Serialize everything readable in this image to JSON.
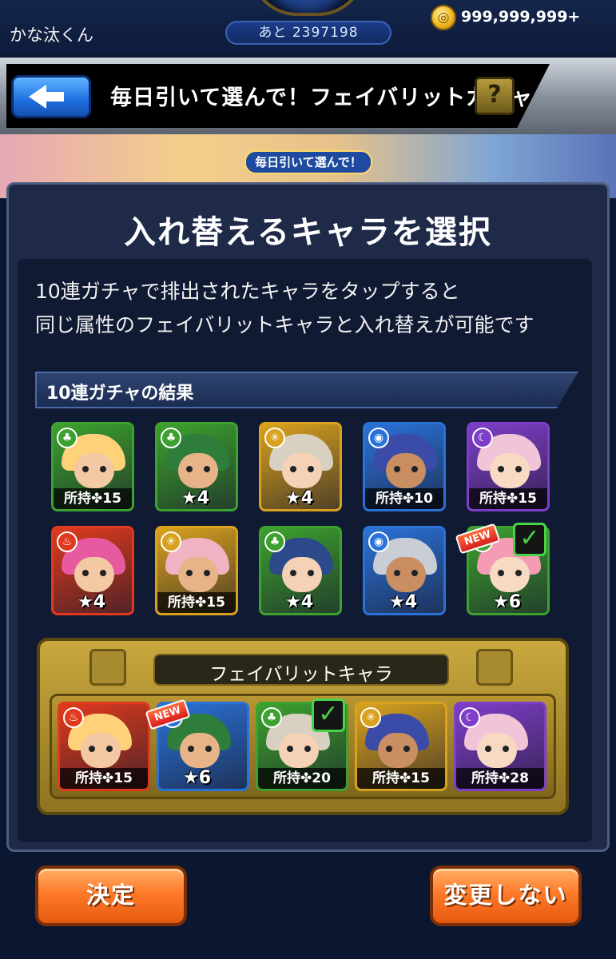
{
  "status": {
    "username": "かな汰くん",
    "exp_remaining": "あと 2397198",
    "coins": "999,999,999+"
  },
  "header": {
    "title": "毎日引いて選んで！フェイバリットガチャ",
    "help_label": "?"
  },
  "banner": {
    "tag": "毎日引いて選んで！"
  },
  "panel": {
    "title": "入れ替えるキャラを選択",
    "description_line1": "10連ガチャで排出されたキャラをタップすると",
    "description_line2": "同じ属性のフェイバリットキャラと入れ替えが可能です",
    "results_header": "10連ガチャの結果"
  },
  "results": [
    {
      "label": "所持✤15",
      "attribute": "wood",
      "badge": "",
      "checked": false
    },
    {
      "label": "★4",
      "attribute": "wood",
      "badge": "",
      "checked": false
    },
    {
      "label": "★4",
      "attribute": "light",
      "badge": "",
      "checked": false
    },
    {
      "label": "所持✤10",
      "attribute": "water",
      "badge": "",
      "checked": false
    },
    {
      "label": "所持✤15",
      "attribute": "dark",
      "badge": "",
      "checked": false
    },
    {
      "label": "★4",
      "attribute": "fire",
      "badge": "",
      "checked": false
    },
    {
      "label": "所持✤15",
      "attribute": "light",
      "badge": "",
      "checked": false
    },
    {
      "label": "★4",
      "attribute": "wood",
      "badge": "",
      "checked": false
    },
    {
      "label": "★4",
      "attribute": "water",
      "badge": "",
      "checked": false
    },
    {
      "label": "★6",
      "attribute": "wood",
      "badge": "NEW",
      "checked": true
    }
  ],
  "favorites": {
    "label": "フェイバリットキャラ",
    "items": [
      {
        "label": "所持✤15",
        "attribute": "fire",
        "badge": "",
        "checked": false
      },
      {
        "label": "★6",
        "attribute": "water",
        "badge": "NEW",
        "checked": false
      },
      {
        "label": "所持✤20",
        "attribute": "wood",
        "badge": "",
        "checked": true
      },
      {
        "label": "所持✤15",
        "attribute": "light",
        "badge": "",
        "checked": false
      },
      {
        "label": "所持✤28",
        "attribute": "dark",
        "badge": "",
        "checked": false
      }
    ]
  },
  "buttons": {
    "confirm": "決定",
    "no_change": "変更しない"
  },
  "colors": {
    "fire": "#e03a1e",
    "water": "#2a72d8",
    "wood": "#3ca12e",
    "light": "#d9a21e",
    "dark": "#7e3ec8",
    "check": "#4ad24a",
    "button": "#ff7a2a"
  }
}
